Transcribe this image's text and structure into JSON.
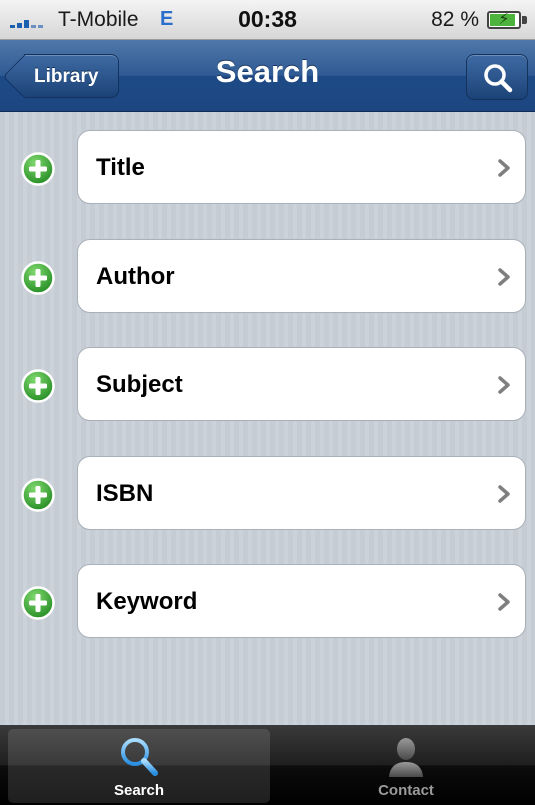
{
  "status_bar": {
    "carrier": "T-Mobile",
    "network": "E",
    "time": "00:38",
    "battery_percent": "82 %",
    "battery_level": 0.82,
    "icons": [
      "signal-icon",
      "battery-charging-icon"
    ]
  },
  "nav_bar": {
    "title": "Search",
    "back_label": "Library",
    "right_button_icon": "search-icon",
    "color": "#1d4a86"
  },
  "rows": [
    {
      "label": "Title"
    },
    {
      "label": "Author"
    },
    {
      "label": "Subject"
    },
    {
      "label": "ISBN"
    },
    {
      "label": "Keyword"
    }
  ],
  "row_icons": {
    "add": "add-circle-icon",
    "chevron": "chevron-right-icon",
    "add_color": "#3aa83a"
  },
  "tab_bar": {
    "tabs": [
      {
        "label": "Search",
        "icon": "search-icon",
        "selected": true
      },
      {
        "label": "Contact",
        "icon": "person-icon",
        "selected": false
      }
    ],
    "accent": "#5ab0ee"
  }
}
